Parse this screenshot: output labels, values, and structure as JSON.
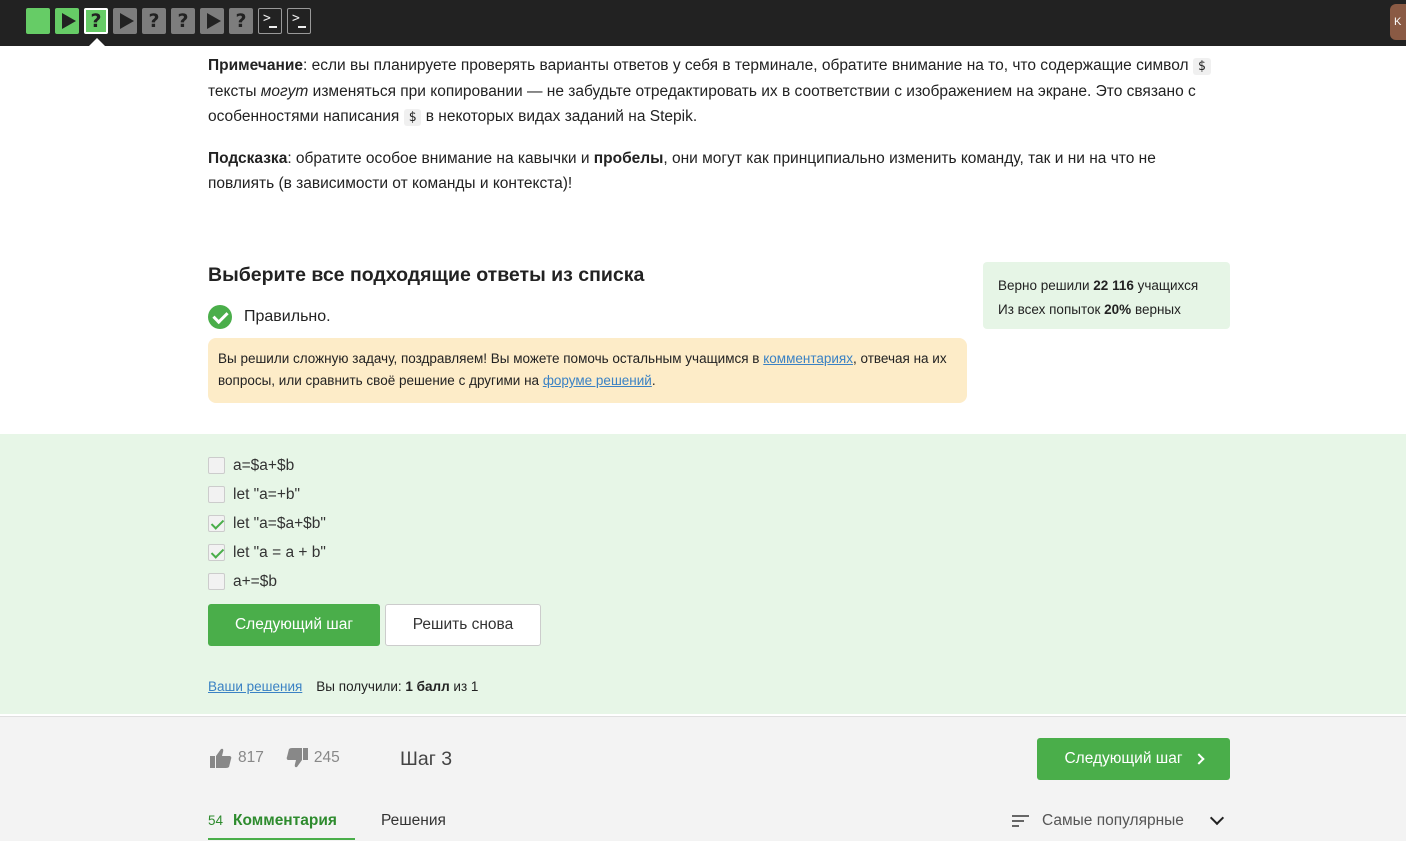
{
  "topbar": {
    "steps": [
      {
        "type": "done-plain",
        "glyph": ""
      },
      {
        "type": "done-play",
        "glyph": ""
      },
      {
        "type": "done-question-current",
        "glyph": "?"
      },
      {
        "type": "play",
        "glyph": ""
      },
      {
        "type": "question",
        "glyph": "?"
      },
      {
        "type": "question",
        "glyph": "?"
      },
      {
        "type": "play",
        "glyph": ""
      },
      {
        "type": "question",
        "glyph": "?"
      },
      {
        "type": "terminal",
        "glyph": ">"
      },
      {
        "type": "terminal",
        "glyph": ">"
      }
    ],
    "avatar_letter": "K",
    "colors": {
      "done": "#66cc66",
      "pending": "#7d7d7d",
      "bar": "#222222"
    }
  },
  "note": {
    "label": "Примечание",
    "text1": ": если вы планируете проверять варианты ответов у себя в терминале, обратите внимание на то, что содержащие символ ",
    "symbol": "$",
    "text2": " тексты ",
    "italic": "могут",
    "text3": " изменяться при копировании — не забудьте отредактировать их в соответствии с изображением на экране. Это связано с особенностями написания ",
    "text4": " в некоторых видах заданий на Stepik."
  },
  "hint": {
    "label": "Подсказка",
    "text1": ": обратите особое внимание на кавычки и ",
    "bold": "пробелы",
    "text2": ", они могут как принципиально изменить команду, так и ни на что не повлиять (в зависимости от команды и контекста)!"
  },
  "question": {
    "title": "Выберите все подходящие ответы из списка",
    "status": "Правильно.",
    "congrats_text1": "Вы решили сложную задачу, поздравляем! Вы можете помочь остальным учащимся в ",
    "congrats_link1": "комментариях",
    "congrats_text2": ", отвечая на их вопросы, или сравнить своё решение с другими на ",
    "congrats_link2": "форуме решений",
    "congrats_text3": "."
  },
  "stats": {
    "line1_pre": "Верно решили ",
    "line1_num": "22 116",
    "line1_post": " учащихся",
    "line2_pre": "Из всех попыток ",
    "line2_num": "20%",
    "line2_post": " верных"
  },
  "options": [
    {
      "label": "a=$a+$b",
      "checked": false
    },
    {
      "label": "let \"a=+b\"",
      "checked": false
    },
    {
      "label": "let \"a=$a+$b\"",
      "checked": true
    },
    {
      "label": "let \"a = a + b\"",
      "checked": true
    },
    {
      "label": "a+=$b",
      "checked": false
    }
  ],
  "buttons": {
    "next": "Следующий шаг",
    "again": "Решить снова"
  },
  "result": {
    "your_solutions": "Ваши решения",
    "got_pre": "Вы получили: ",
    "got_bold": "1 балл",
    "got_post": " из 1"
  },
  "footer": {
    "likes": "817",
    "dislikes": "245",
    "step": "Шаг 3",
    "next": "Следующий шаг",
    "comments_count": "54",
    "comments_tab": "Комментария",
    "solutions_tab": "Решения",
    "sort": "Самые популярные"
  }
}
